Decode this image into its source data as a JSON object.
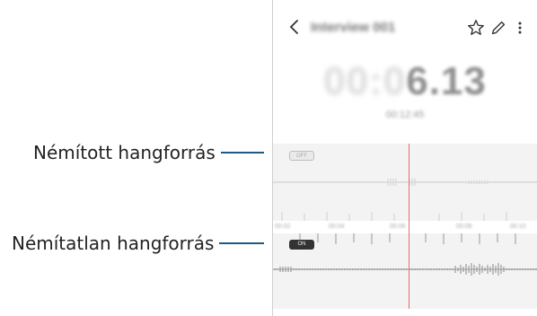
{
  "callouts": {
    "muted_label": "Némított hangforrás",
    "unmuted_label": "Némítatlan hangforrás"
  },
  "app": {
    "title": "Interview 001",
    "timer_dim": "00:0",
    "timer_bright": "6.13",
    "sub_time": "00:12:45"
  },
  "tracks": {
    "muted_pill": "OFF",
    "unmuted_pill": "ON",
    "ruler_labels": [
      "00:02",
      "00:04",
      "00:06",
      "00:08",
      "00:10"
    ]
  },
  "colors": {
    "leader": "#1f5a86",
    "playhead": "#e07070"
  },
  "icons": [
    "back-arrow-icon",
    "star-icon",
    "pencil-icon",
    "more-vert-icon"
  ]
}
